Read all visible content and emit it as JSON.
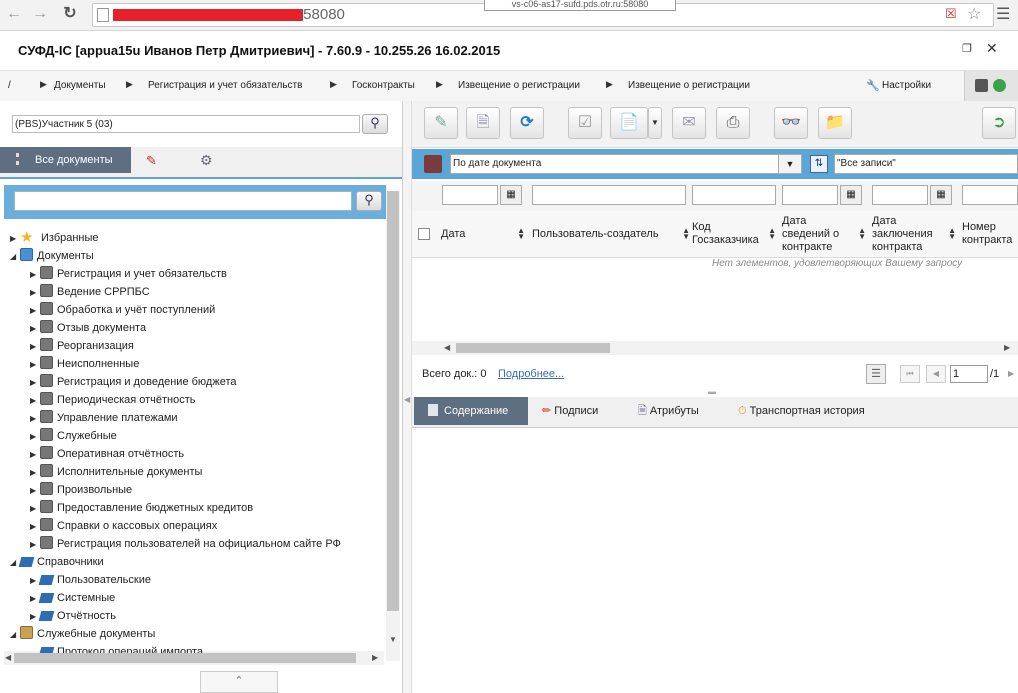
{
  "browser": {
    "url_visible": ":58080",
    "tooltip": "vs-c06-as17-sufd.pds.otr.ru:58080"
  },
  "app": {
    "title": "СУФД-IC [appua15u Иванов Петр Дмитриевич] - 7.60.9 - 10.255.26 16.02.2015"
  },
  "breadcrumb": {
    "root": "/",
    "items": [
      "Документы",
      "Регистрация и учет обязательств",
      "Госконтракты",
      "Извещение о регистрации",
      "Извещение о регистрации"
    ],
    "settings_label": "Настройки"
  },
  "left_panel": {
    "org_select": "(PBS)Участник 5 (03)",
    "tab_all_docs": "Все документы",
    "tree": [
      {
        "label": "Избранные",
        "icon": "star-icon",
        "level": 0,
        "expanded": false
      },
      {
        "label": "Документы",
        "icon": "documents-icon",
        "level": 0,
        "expanded": true
      },
      {
        "label": "Регистрация и учет обязательств",
        "icon": "book-icon",
        "level": 1
      },
      {
        "label": "Ведение СРРПБС",
        "icon": "book-icon",
        "level": 1
      },
      {
        "label": "Обработка и учёт поступлений",
        "icon": "book-icon",
        "level": 1
      },
      {
        "label": "Отзыв документа",
        "icon": "book-icon",
        "level": 1
      },
      {
        "label": "Реорганизация",
        "icon": "book-icon",
        "level": 1
      },
      {
        "label": "Неисполненные",
        "icon": "book-icon",
        "level": 1
      },
      {
        "label": "Регистрация и доведение бюджета",
        "icon": "book-icon",
        "level": 1
      },
      {
        "label": "Периодическая отчётность",
        "icon": "book-icon",
        "level": 1
      },
      {
        "label": "Управление платежами",
        "icon": "book-icon",
        "level": 1
      },
      {
        "label": "Служебные",
        "icon": "book-icon",
        "level": 1
      },
      {
        "label": "Оперативная отчётность",
        "icon": "book-icon",
        "level": 1
      },
      {
        "label": "Исполнительные документы",
        "icon": "book-icon",
        "level": 1
      },
      {
        "label": "Произвольные",
        "icon": "book-icon",
        "level": 1
      },
      {
        "label": "Предоставление бюджетных кредитов",
        "icon": "book-icon",
        "level": 1
      },
      {
        "label": "Справки о кассовых операциях",
        "icon": "book-icon",
        "level": 1
      },
      {
        "label": "Регистрация пользователей на официальном сайте РФ",
        "icon": "book-icon",
        "level": 1
      },
      {
        "label": "Справочники",
        "icon": "references-icon",
        "level": 0,
        "expanded": true
      },
      {
        "label": "Пользовательские",
        "icon": "references-icon",
        "level": 1
      },
      {
        "label": "Системные",
        "icon": "references-icon",
        "level": 1
      },
      {
        "label": "Отчётность",
        "icon": "references-icon",
        "level": 1
      },
      {
        "label": "Служебные документы",
        "icon": "service-docs-icon",
        "level": 0,
        "expanded": true
      },
      {
        "label": "Протокол операций импорта",
        "icon": "protocol-icon",
        "level": 1
      }
    ]
  },
  "right_panel": {
    "sort_select": "По дате документа",
    "filter_select": "\"Все записи\"",
    "columns": [
      "Дата",
      "Пользователь-создатель",
      "Код Госзаказчика",
      "Дата сведений о контракте",
      "Дата заключения контракта",
      "Номер контракта"
    ],
    "empty_message": "Нет элементов, удовлетворяющих Вашему запросу",
    "total_label": "Всего док.: 0",
    "more_link": "Подробнее...",
    "page_current": "1",
    "page_total": "/1",
    "bottom_tabs": [
      "Содержание",
      "Подписи",
      "Атрибуты",
      "Транспортная история"
    ]
  },
  "colors": {
    "accent_blue": "#5aa7d7",
    "active_tab": "#5d6f80",
    "redaction": "#e8202a"
  }
}
